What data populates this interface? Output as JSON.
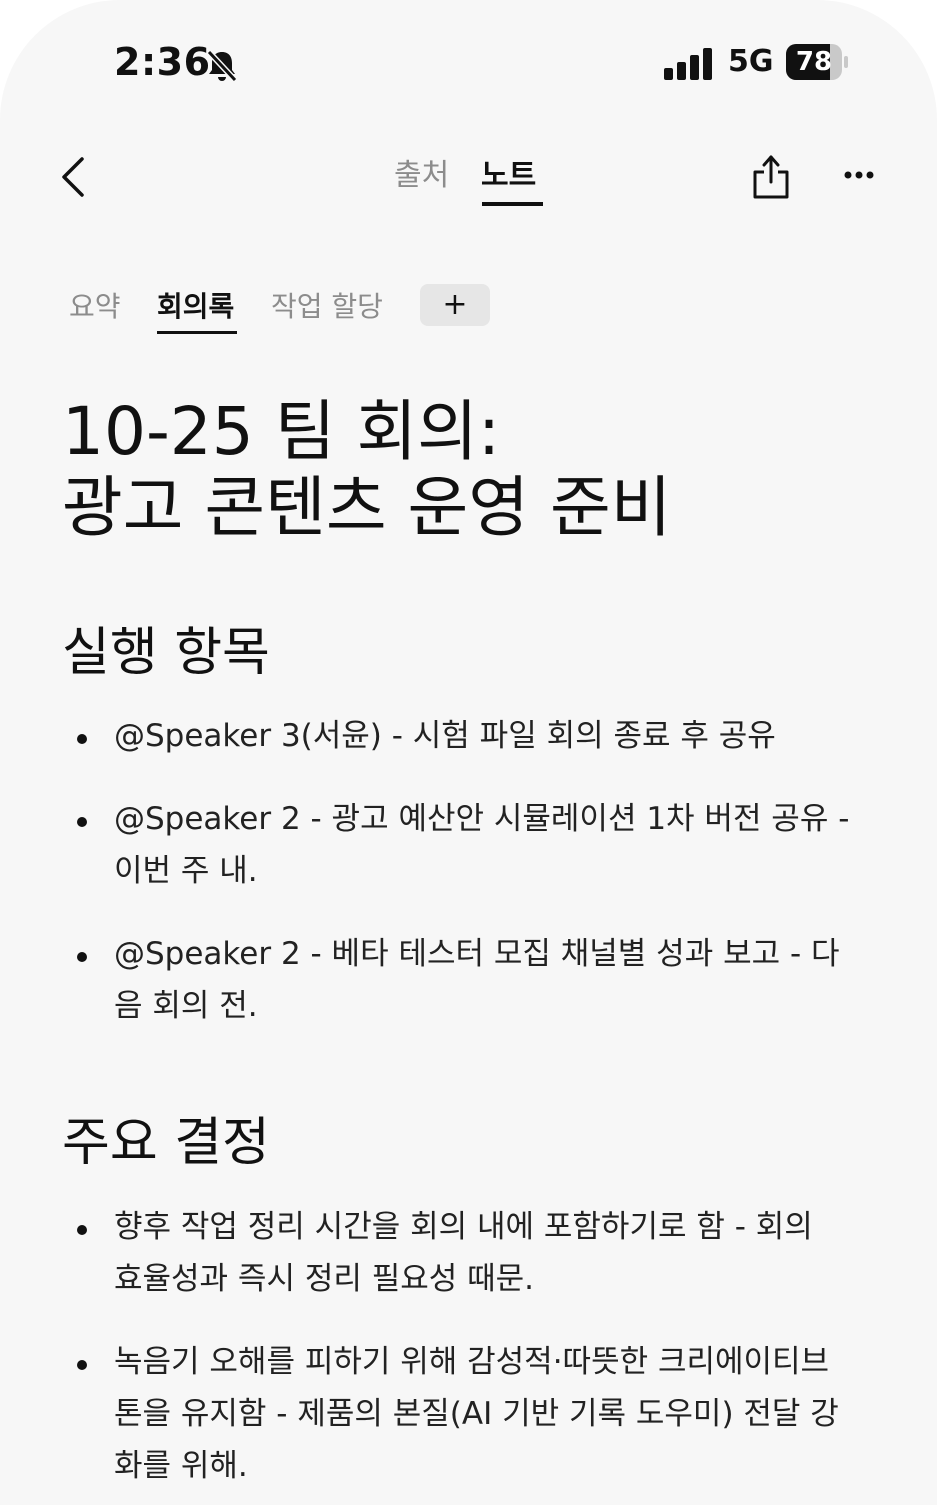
{
  "status_bar": {
    "time": "2:36",
    "network": "5G",
    "battery": "78",
    "battery_level": 0.78
  },
  "nav": {
    "tabs": [
      {
        "label": "출처",
        "active": false
      },
      {
        "label": "노트",
        "active": true
      }
    ],
    "icons": [
      "chevron-left-icon",
      "share-icon",
      "more-icon"
    ]
  },
  "subtabs": {
    "items": [
      {
        "label": "요약",
        "active": false
      },
      {
        "label": "회의록",
        "active": true
      },
      {
        "label": "작업 할당",
        "active": false
      }
    ],
    "add_label": "+"
  },
  "title": {
    "line1": "10-25 팀 회의:",
    "line2": "광고 콘텐츠 운영 준비"
  },
  "sections": [
    {
      "heading": "실행 항목",
      "items": [
        {
          "line1": "@Speaker 3(서윤) - 시험 파일 회의 종료 후 공유"
        },
        {
          "line1": "@Speaker 2 - 광고 예산안 시뮬레이션 1차 버전 공유 -",
          "line2": "이번 주 내."
        },
        {
          "line1": "@Speaker 2 - 베타 테스터 모집 채널별 성과 보고 - 다",
          "line2": "음 회의 전."
        }
      ]
    },
    {
      "heading": "주요 결정",
      "items": [
        {
          "line1": "향후 작업 정리 시간을 회의 내에 포함하기로 함 - 회의",
          "line2": "효율성과 즉시 정리 필요성 때문."
        },
        {
          "line1": "녹음기 오해를 피하기 위해 감성적·따뜻한 크리에이티브",
          "line2": "톤을 유지함 - 제품의 본질(AI 기반 기록 도우미) 전달 강",
          "line3": "화를 위해."
        }
      ]
    }
  ]
}
